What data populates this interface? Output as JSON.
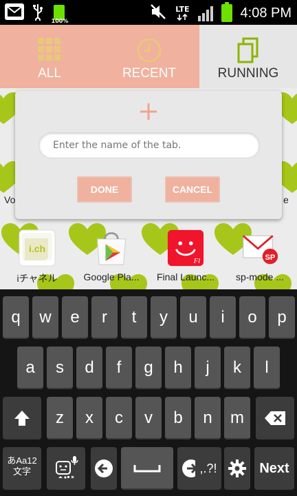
{
  "status_bar": {
    "battery_label": "100%",
    "network": "LTE",
    "time": "4:08 PM"
  },
  "tabs": [
    {
      "label": "ALL",
      "icon": "grid-icon",
      "selected": false
    },
    {
      "label": "RECENT",
      "icon": "clock-icon",
      "selected": false
    },
    {
      "label": "RUNNING",
      "icon": "stack-icon",
      "selected": true
    }
  ],
  "background": {
    "peek_left": "Vo",
    "peek_right": "e"
  },
  "apps": [
    {
      "label": "iチャネル",
      "icon": "ichannel-icon"
    },
    {
      "label": "Google Pla...",
      "icon": "play-store-icon"
    },
    {
      "label": "Final Launc...",
      "icon": "final-launcher-icon"
    },
    {
      "label": "sp-mode ...",
      "icon": "sp-mode-mail-icon"
    }
  ],
  "dialog": {
    "icon": "plus-icon",
    "input_placeholder": "Enter the name of the tab.",
    "input_value": "",
    "done_label": "DONE",
    "cancel_label": "CANCEL"
  },
  "keyboard": {
    "row1": [
      "q",
      "w",
      "e",
      "r",
      "t",
      "y",
      "u",
      "i",
      "o",
      "p"
    ],
    "row2": [
      "a",
      "s",
      "d",
      "f",
      "g",
      "h",
      "j",
      "k",
      "l"
    ],
    "row3": [
      "z",
      "x",
      "c",
      "v",
      "b",
      "n",
      "m"
    ],
    "mode_key_top": "あAa12",
    "mode_key_bottom": "文字",
    "punct_key": ",.?!",
    "next_label": "Next"
  },
  "colors": {
    "accent": "#f0b19e",
    "heart": "#a6c71a",
    "battery": "#6ee000"
  }
}
